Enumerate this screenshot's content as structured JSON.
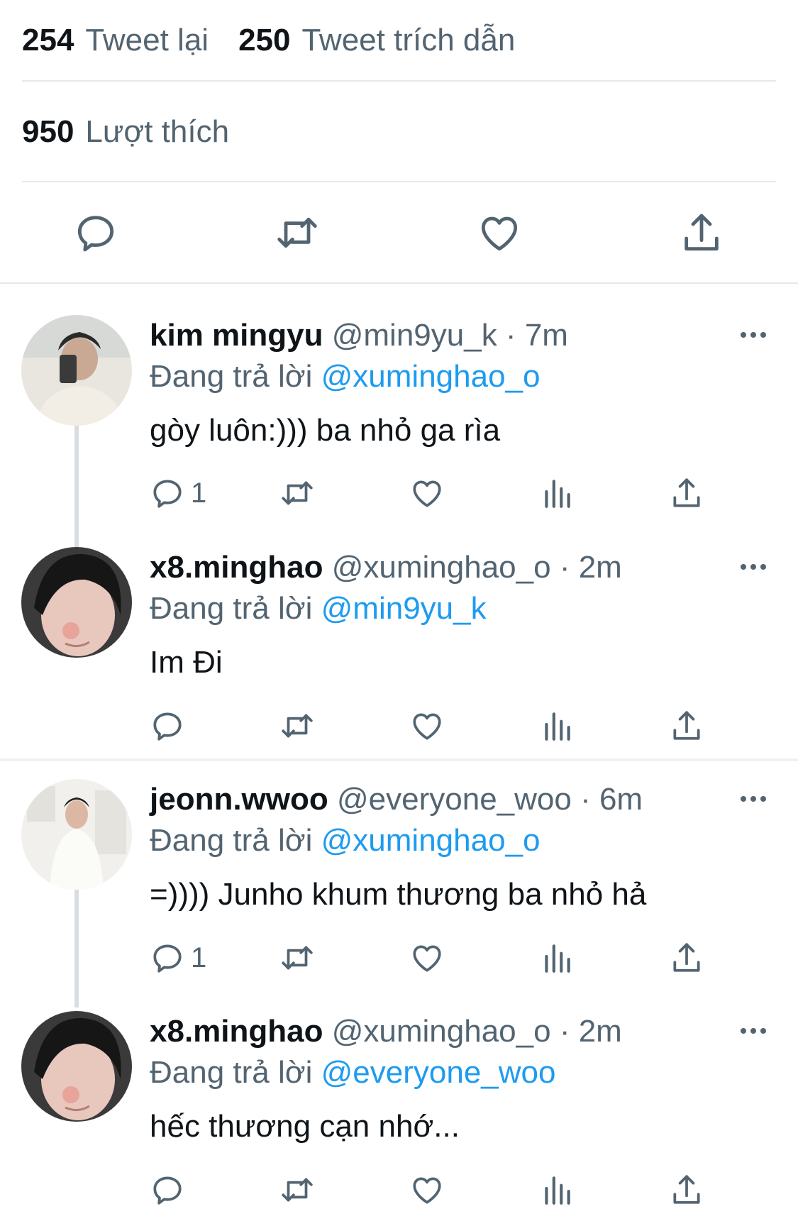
{
  "stats": {
    "retweets_count": "254",
    "retweets_label": "Tweet lại",
    "quotes_count": "250",
    "quotes_label": "Tweet trích dẫn",
    "likes_count": "950",
    "likes_label": "Lượt thích"
  },
  "colors": {
    "accent": "#1d9bf0",
    "muted": "#536471",
    "text": "#0f1419"
  },
  "icons": [
    "reply-icon",
    "retweet-icon",
    "like-icon",
    "share-icon",
    "analytics-icon",
    "more-icon"
  ],
  "replies": [
    {
      "name": "kim mingyu",
      "meta": "@min9yu_k · 7m",
      "replying_label": "Đang trả lời",
      "mention": "@xuminghao_o",
      "text": "gòy luôn:))) ba nhỏ ga rìa",
      "reply_count": "1"
    },
    {
      "name": "x8.minghao",
      "meta": "@xuminghao_o · 2m",
      "replying_label": "Đang trả lời",
      "mention": "@min9yu_k",
      "text": "Im Đi",
      "reply_count": ""
    },
    {
      "name": "jeonn.wwoo",
      "meta": "@everyone_woo · 6m",
      "replying_label": "Đang trả lời",
      "mention": "@xuminghao_o",
      "text": "=)))) Junho khum thương ba nhỏ hả",
      "reply_count": "1"
    },
    {
      "name": "x8.minghao",
      "meta": "@xuminghao_o · 2m",
      "replying_label": "Đang trả lời",
      "mention": "@everyone_woo",
      "text": "hếc thương cạn nhớ...",
      "reply_count": ""
    }
  ]
}
